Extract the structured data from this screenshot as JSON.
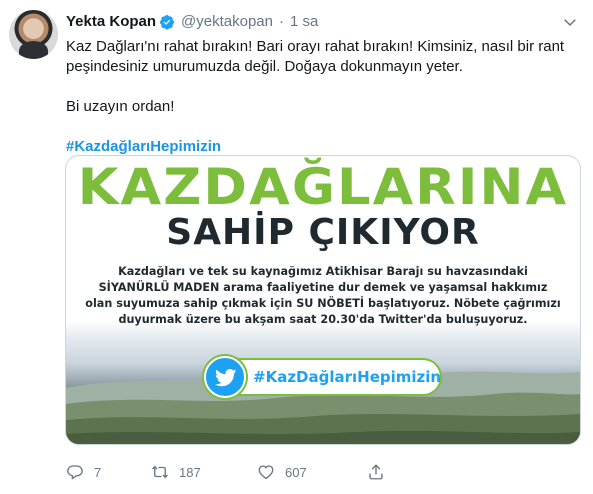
{
  "tweet": {
    "author_name": "Yekta Kopan",
    "handle": "@yektakopan",
    "separator": "·",
    "time": "1 sa",
    "text_lines": [
      "Kaz Dağları'nı rahat bırakın! Bari orayı rahat bırakın! Kimsiniz, nasıl bir rant",
      "peşindesiniz umurumuzda değil. Doğaya dokunmayın yeter."
    ],
    "text_line_2": "Bi uzayın ordan!",
    "hashtag": "#KazdağlarıHepimizin"
  },
  "media": {
    "title": "KAZDAĞLARINA",
    "subtitle": "SAHİP ÇIKIYOR",
    "description_lines": [
      "Kazdağları ve tek su kaynağımız Atikhisar Barajı su havzasındaki",
      "SİYANÜRLÜ MADEN arama faaliyetine dur demek ve yaşamsal hakkımız",
      "olan suyumuza sahip çıkmak için SU NÖBETİ başlatıyoruz. Nöbete çağrımızı",
      "duyurmak üzere bu akşam saat 20.30'da Twitter'da buluşuyoruz."
    ],
    "badge_text": "#KazDağlarıHepimizin"
  },
  "actions": {
    "reply_count": "7",
    "retweet_count": "187",
    "like_count": "607"
  },
  "colors": {
    "link_blue": "#1b95e0",
    "verified_blue": "#1da1f2",
    "title_green": "#7cbd3b",
    "muted_gray": "#657786"
  },
  "icons": [
    "avatar",
    "verified-badge-icon",
    "chevron-down-icon",
    "reply-icon",
    "retweet-icon",
    "like-icon",
    "share-icon",
    "twitter-bird-icon"
  ]
}
